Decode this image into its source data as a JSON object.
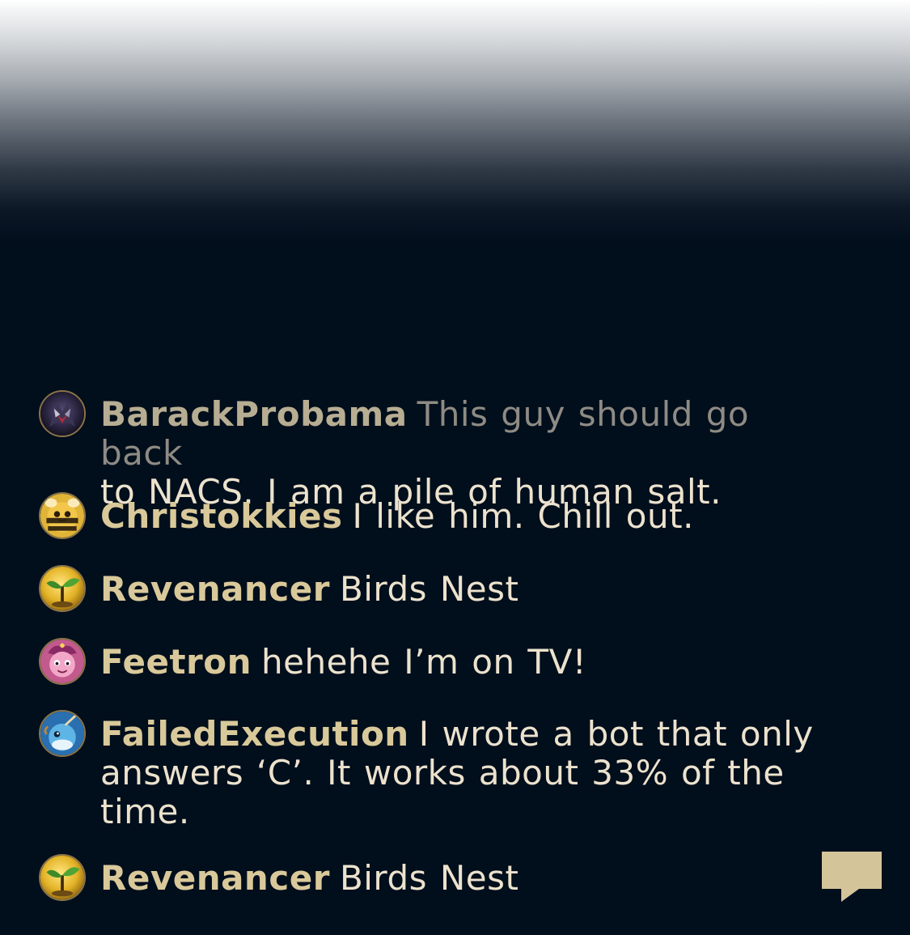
{
  "chat": {
    "messages": [
      {
        "username": "BarackProbama",
        "text_part1": "This guy should go back",
        "text_part2": "to NACS. I am a pile of human salt.",
        "avatar_icon": "dark-champion-portrait-icon"
      },
      {
        "username": "Christokkies",
        "text": "I like him. Chill out.",
        "avatar_icon": "bee-portrait-icon"
      },
      {
        "username": "Revenancer",
        "text": "Birds Nest",
        "avatar_icon": "sprout-portrait-icon"
      },
      {
        "username": "Feetron",
        "text": "hehehe I’m on TV!",
        "avatar_icon": "pink-creature-portrait-icon"
      },
      {
        "username": "FailedExecution",
        "text": "I wrote a bot that only answers ‘C’. It works about 33% of the time.",
        "avatar_icon": "narwhal-portrait-icon"
      },
      {
        "username": "Revenancer",
        "text": "Birds Nest",
        "avatar_icon": "sprout-portrait-icon"
      }
    ]
  },
  "colors": {
    "background": "#010e1c",
    "username": "#d9c99a",
    "message_text": "#ece2cd",
    "faded_text": "#8e8b84",
    "chat_button": "#d4c49a"
  },
  "controls": {
    "chat_toggle_icon": "speech-bubble-icon"
  }
}
